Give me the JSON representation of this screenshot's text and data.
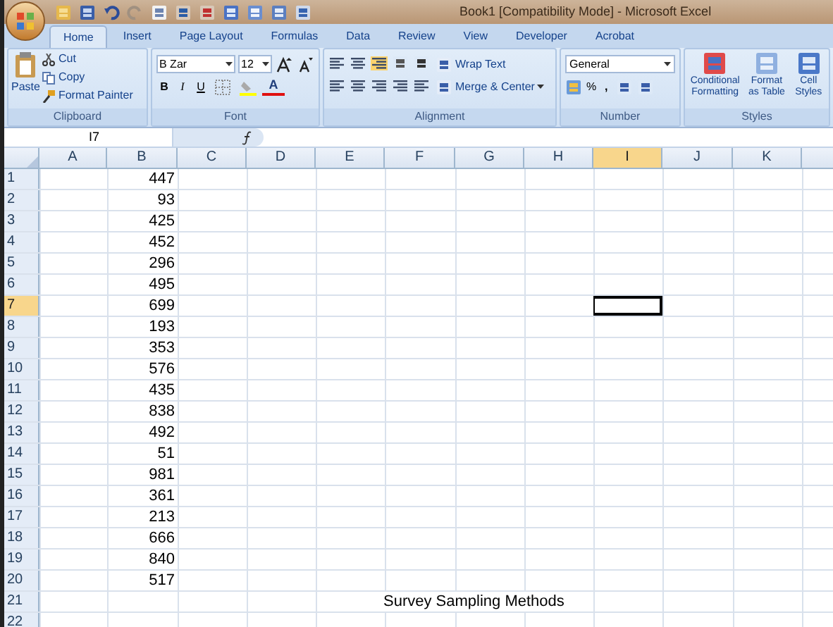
{
  "window": {
    "title": "Book1  [Compatibility Mode] - Microsoft Excel"
  },
  "tabs": [
    {
      "label": "Home",
      "selected": true
    },
    {
      "label": "Insert",
      "selected": false
    },
    {
      "label": "Page Layout",
      "selected": false
    },
    {
      "label": "Formulas",
      "selected": false
    },
    {
      "label": "Data",
      "selected": false
    },
    {
      "label": "Review",
      "selected": false
    },
    {
      "label": "View",
      "selected": false
    },
    {
      "label": "Developer",
      "selected": false
    },
    {
      "label": "Acrobat",
      "selected": false
    }
  ],
  "ribbon": {
    "clipboard": {
      "paste": "Paste",
      "cut": "Cut",
      "copy": "Copy",
      "format_painter": "Format Painter",
      "label": "Clipboard"
    },
    "font": {
      "font_name": "B Zar",
      "font_size": "12",
      "bold": "B",
      "italic": "I",
      "underline": "U",
      "font_color": "A",
      "label": "Font"
    },
    "alignment": {
      "wrap_text": "Wrap Text",
      "merge_center": "Merge & Center",
      "label": "Alignment"
    },
    "number": {
      "format": "General",
      "percent": "%",
      "comma": ",",
      "label": "Number"
    },
    "styles": {
      "conditional_formatting": "Conditional Formatting",
      "format_as_table": "Format as Table",
      "cell_styles": "Cell Styles",
      "label": "Styles"
    }
  },
  "formula_bar": {
    "name_box": "I7"
  },
  "columns": [
    {
      "label": "A",
      "selected": false
    },
    {
      "label": "B",
      "selected": false
    },
    {
      "label": "C",
      "selected": false
    },
    {
      "label": "D",
      "selected": false
    },
    {
      "label": "E",
      "selected": false
    },
    {
      "label": "F",
      "selected": false
    },
    {
      "label": "G",
      "selected": false
    },
    {
      "label": "H",
      "selected": false
    },
    {
      "label": "I",
      "selected": true
    },
    {
      "label": "J",
      "selected": false
    },
    {
      "label": "K",
      "selected": false
    }
  ],
  "rows": [
    {
      "label": "1",
      "selected": false,
      "column_b": "447"
    },
    {
      "label": "2",
      "selected": false,
      "column_b": "93"
    },
    {
      "label": "3",
      "selected": false,
      "column_b": "425"
    },
    {
      "label": "4",
      "selected": false,
      "column_b": "452"
    },
    {
      "label": "5",
      "selected": false,
      "column_b": "296"
    },
    {
      "label": "6",
      "selected": false,
      "column_b": "495"
    },
    {
      "label": "7",
      "selected": true,
      "column_b": "699"
    },
    {
      "label": "8",
      "selected": false,
      "column_b": "193"
    },
    {
      "label": "9",
      "selected": false,
      "column_b": "353"
    },
    {
      "label": "10",
      "selected": false,
      "column_b": "576"
    },
    {
      "label": "11",
      "selected": false,
      "column_b": "435"
    },
    {
      "label": "12",
      "selected": false,
      "column_b": "838"
    },
    {
      "label": "13",
      "selected": false,
      "column_b": "492"
    },
    {
      "label": "14",
      "selected": false,
      "column_b": "51"
    },
    {
      "label": "15",
      "selected": false,
      "column_b": "981"
    },
    {
      "label": "16",
      "selected": false,
      "column_b": "361"
    },
    {
      "label": "17",
      "selected": false,
      "column_b": "213"
    },
    {
      "label": "18",
      "selected": false,
      "column_b": "666"
    },
    {
      "label": "19",
      "selected": false,
      "column_b": "840"
    },
    {
      "label": "20",
      "selected": false,
      "column_b": "517"
    },
    {
      "label": "21",
      "selected": false,
      "column_f": "Survey Sampling Methods"
    },
    {
      "label": "22",
      "selected": false
    }
  ]
}
